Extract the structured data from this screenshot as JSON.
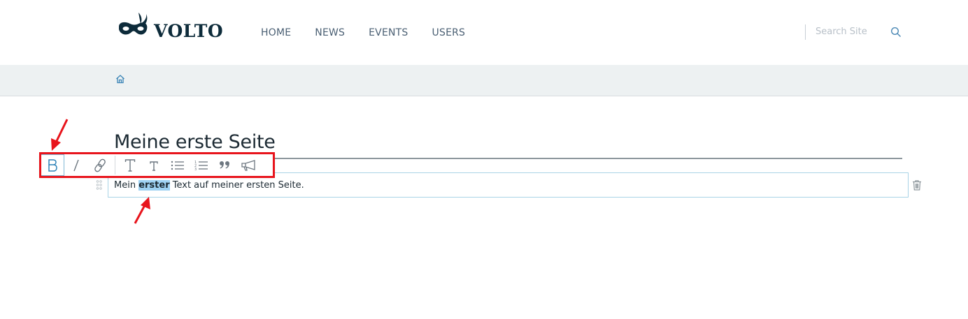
{
  "header": {
    "logo_text": "VOLTO",
    "nav": [
      "HOME",
      "NEWS",
      "EVENTS",
      "USERS"
    ],
    "search_placeholder": "Search Site"
  },
  "breadcrumb": {
    "icon": "home-icon"
  },
  "page": {
    "title": "Meine erste Seite",
    "text_before": "Mein ",
    "text_selected": "erster",
    "text_after": " Text auf meiner ersten Seite."
  },
  "toolbar": {
    "buttons": [
      "bold",
      "italic",
      "link",
      "heading-2",
      "heading-3",
      "bulleted-list",
      "numbered-list",
      "blockquote",
      "callout"
    ]
  },
  "colors": {
    "accent": "#2c82b7",
    "annotation": "#e8141c",
    "selection": "#9fd2f3"
  }
}
